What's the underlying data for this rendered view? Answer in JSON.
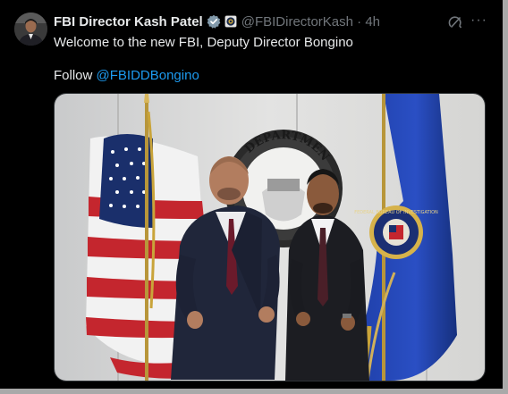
{
  "tweet": {
    "author_name": "FBI Director Kash Patel",
    "handle": "@FBIDirectorKash",
    "separator": "·",
    "time": "4h",
    "text_line1": "Welcome to the new FBI, Deputy Director Bongino",
    "follow_prefix": "Follow ",
    "mention": "@FBIDDBongino",
    "more_label": "···"
  },
  "photo": {
    "seal_text": "DEPARTMENT OF JUSTICE",
    "flag_text": "FEDERAL BUREAU OF INVESTIGATION"
  }
}
